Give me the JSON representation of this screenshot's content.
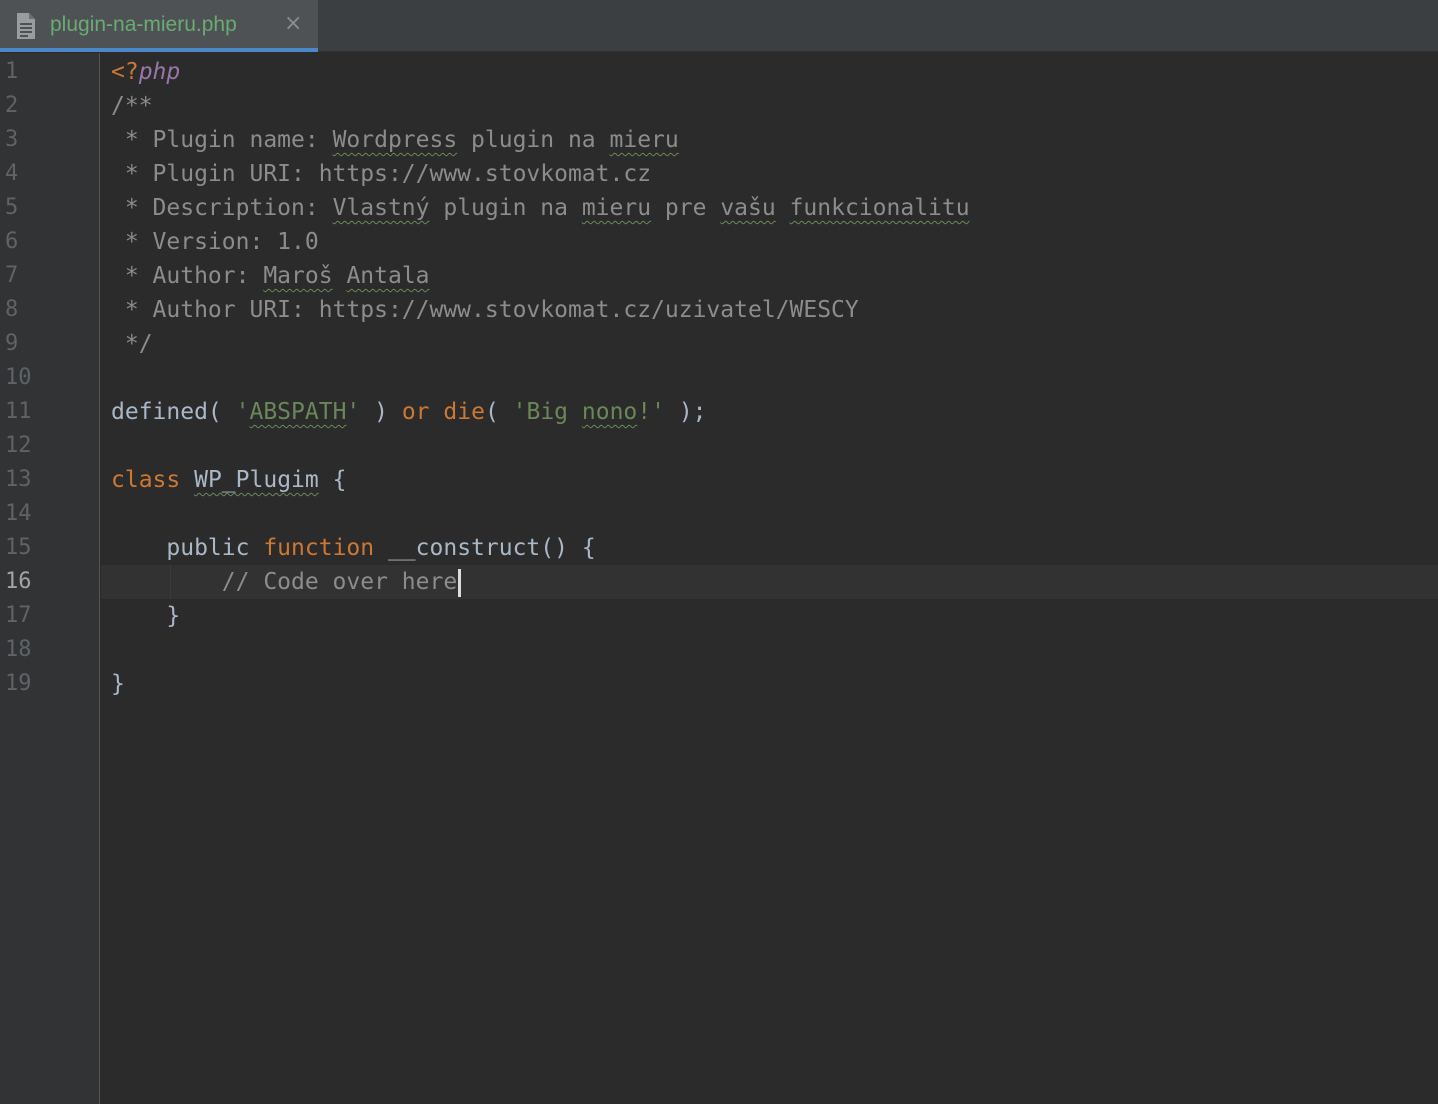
{
  "tab": {
    "title": "plugin-na-mieru.php",
    "close_glyph": "×"
  },
  "editor": {
    "current_line": 16
  },
  "line_numbers": [
    "1",
    "2",
    "3",
    "4",
    "5",
    "6",
    "7",
    "8",
    "9",
    "10",
    "11",
    "12",
    "13",
    "14",
    "15",
    "16",
    "17",
    "18",
    "19"
  ],
  "code": {
    "l1_open": "<?",
    "l1_php": "php",
    "l2": "/**",
    "l3_a": " * Plugin name: ",
    "l3_b": "Wordpress",
    "l3_c": " plugin na ",
    "l3_d": "mieru",
    "l4": " * Plugin URI: https://www.stovkomat.cz",
    "l5_a": " * Description: ",
    "l5_b": "Vlastný",
    "l5_c": " plugin na ",
    "l5_d": "mieru",
    "l5_e": " pre ",
    "l5_f": "vašu",
    "l5_g": " ",
    "l5_h": "funkcionalitu",
    "l6": " * Version: 1.0",
    "l7_a": " * Author: ",
    "l7_b": "Maroš",
    "l7_c": " ",
    "l7_d": "Antala",
    "l8": " * Author URI: https://www.stovkomat.cz/uzivatel/WESCY",
    "l9": " */",
    "l11_a": "defined( ",
    "l11_b": "'",
    "l11_c": "ABSPATH",
    "l11_d": "'",
    "l11_e": " ) ",
    "l11_f": "or",
    "l11_g": " ",
    "l11_h": "die",
    "l11_i": "( ",
    "l11_j": "'Big ",
    "l11_k": "nono",
    "l11_l": "!'",
    "l11_m": " );",
    "l13_a": "class",
    "l13_b": " ",
    "l13_c": "WP_Plugim",
    "l13_d": " {",
    "l15_a": "    public ",
    "l15_b": "function",
    "l15_c": " __construct() {",
    "l16": "        // Code over here",
    "l17": "    }",
    "l19": "}"
  },
  "colors": {
    "background": "#2b2b2b",
    "keyword": "#cc7832",
    "string": "#6a8759",
    "comment": "#8c8c8c",
    "text": "#a9b7c6",
    "php_tag": "#9876aa",
    "tab_title": "#6aab73",
    "tab_underline": "#4a88c7"
  },
  "icons": {
    "tab": "php-file-icon",
    "close": "close-icon"
  }
}
